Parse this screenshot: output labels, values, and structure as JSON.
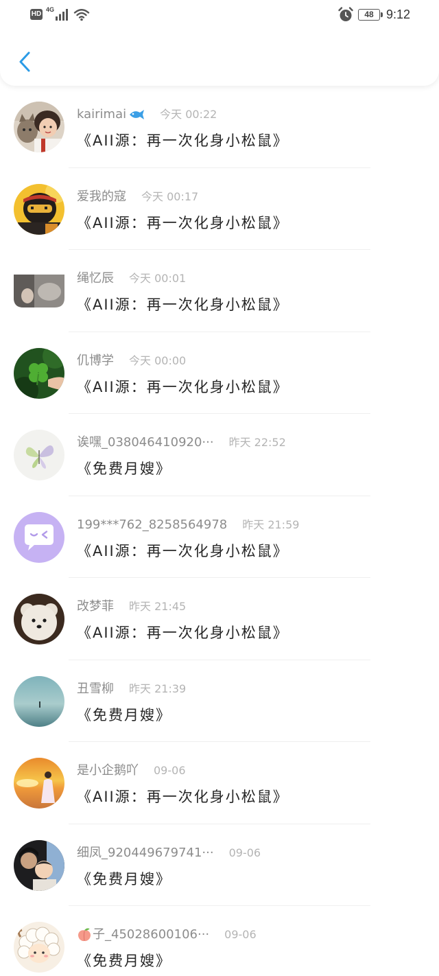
{
  "status_bar": {
    "hd": "HD",
    "network": "4G",
    "battery": "48",
    "time": "9:12",
    "icons": [
      "hd-badge",
      "signal-icon",
      "wifi-icon",
      "alarm-icon",
      "battery-icon"
    ]
  },
  "header": {
    "back_icon": "chevron-left-icon",
    "accent_color": "#2b9be6"
  },
  "colors": {
    "name": "#8c8c8c",
    "time": "#b4b4b4",
    "content": "#262626",
    "divider": "#efefef",
    "icon": "#555555"
  },
  "messages": [
    {
      "name": "kairimai",
      "name_icon": "fish-icon",
      "time": "今天 00:22",
      "content": "《AII源：再一次化身小松鼠》"
    },
    {
      "name": "爱我的寇",
      "time": "今天 00:17",
      "content": "《AII源：再一次化身小松鼠》"
    },
    {
      "name": "绳忆辰",
      "time": "今天 00:01",
      "content": "《AII源：再一次化身小松鼠》"
    },
    {
      "name": "仉博学",
      "time": "今天 00:00",
      "content": "《AII源：再一次化身小松鼠》"
    },
    {
      "name": "诶嘿_038046410920···",
      "time": "昨天 22:52",
      "content": "《免费月嫂》"
    },
    {
      "name": "199***762_8258564978",
      "time": "昨天 21:59",
      "content": "《AII源：再一次化身小松鼠》"
    },
    {
      "name": "改梦菲",
      "time": "昨天 21:45",
      "content": "《AII源：再一次化身小松鼠》"
    },
    {
      "name": "丑雪柳",
      "time": "昨天 21:39",
      "content": "《免费月嫂》"
    },
    {
      "name": "是小企鹅吖",
      "time": "09-06",
      "content": "《AII源：再一次化身小松鼠》"
    },
    {
      "name": "细凤_920449679741···",
      "time": "09-06",
      "content": "《免费月嫂》"
    },
    {
      "name": "子_45028600106···",
      "name_icon": "peach-icon",
      "time": "09-06",
      "content": "《免费月嫂》"
    }
  ]
}
